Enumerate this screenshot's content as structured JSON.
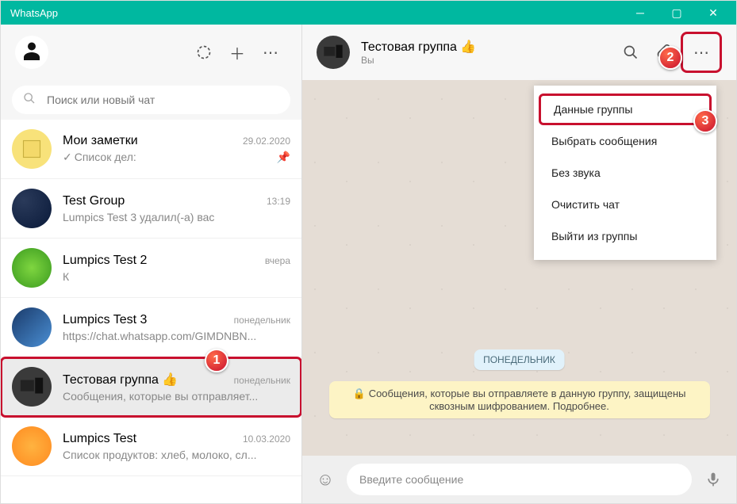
{
  "titlebar": {
    "title": "WhatsApp"
  },
  "sidebar": {
    "search_placeholder": "Поиск или новый чат"
  },
  "chats": [
    {
      "name": "Мои заметки",
      "time": "29.02.2020",
      "preview": "Список дел:",
      "checked": true,
      "pinned": true
    },
    {
      "name": "Test Group",
      "time": "13:19",
      "preview": "Lumpics Test 3 удалил(-а) вас"
    },
    {
      "name": "Lumpics Test 2",
      "time": "вчера",
      "preview": "К"
    },
    {
      "name": "Lumpics Test 3",
      "time": "понедельник",
      "preview": "https://chat.whatsapp.com/GIMDNBN..."
    },
    {
      "name": "Тестовая группа 👍",
      "time": "понедельник",
      "preview": "Сообщения, которые вы отправляет...",
      "selected": true
    },
    {
      "name": "Lumpics Test",
      "time": "10.03.2020",
      "preview": "Список продуктов: хлеб, молоко, сл..."
    }
  ],
  "chat_header": {
    "title": "Тестовая группа 👍",
    "subtitle": "Вы"
  },
  "menu": {
    "items": [
      "Данные группы",
      "Выбрать сообщения",
      "Без звука",
      "Очистить чат",
      "Выйти из группы"
    ]
  },
  "day_label": "ПОНЕДЕЛЬНИК",
  "encryption": "Сообщения, которые вы отправляете в данную группу, защищены сквозным шифрованием. Подробнее.",
  "composer": {
    "placeholder": "Введите сообщение"
  },
  "annotations": {
    "a1": "1",
    "a2": "2",
    "a3": "3"
  }
}
